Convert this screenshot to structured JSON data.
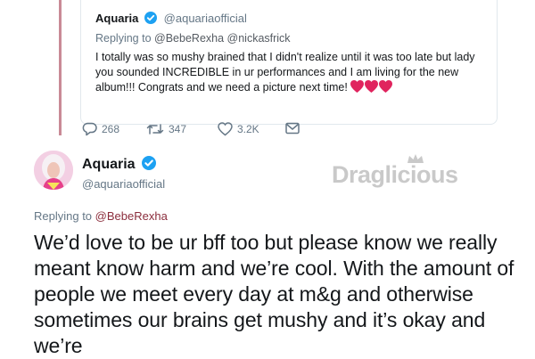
{
  "quoted_tweet": {
    "author_name": "Aquaria",
    "author_handle": "@aquariaofficial",
    "replying_prefix": "Replying to",
    "replying_mentions": "@BebeRexha @nickasfrick",
    "text": "I totally was so mushy brained that I didn't realize until it was too late but lady you sounded INCREDIBLE in ur performances and I am living for the new album!!! Congrats and we need a picture next time!",
    "emoji": "red-hearts",
    "replies": "268",
    "retweets": "347",
    "likes": "3.2K"
  },
  "main_tweet": {
    "author_name": "Aquaria",
    "author_handle": "@aquariaofficial",
    "replying_prefix": "Replying to",
    "replying_mention": "@BebeRexha",
    "text": "We’d love to be ur bff too but please know we really meant know harm and we’re cool. With the amount of people we meet every day at m&g and otherwise sometimes our brains get mushy and it’s okay and we’re"
  },
  "watermark": {
    "prefix": "Drag",
    "suffix": "licious",
    "logo": "crown-icon"
  },
  "colors": {
    "verified": "#1da1f2",
    "heart": "#e0245e",
    "thread_line": "#c98a96",
    "watermark": "#c9c9c9"
  }
}
